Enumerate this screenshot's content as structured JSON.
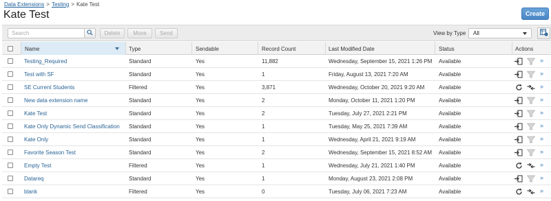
{
  "breadcrumb": {
    "items": [
      "Data Extensions",
      "Testing",
      "Kate Test"
    ],
    "separator": ">"
  },
  "page": {
    "title": "Kate Test"
  },
  "header": {
    "create_label": "Create"
  },
  "toolbar": {
    "search_placeholder": "Search",
    "delete_label": "Delete",
    "move_label": "Move",
    "send_label": "Send",
    "view_by_label": "View by Type",
    "view_by_value": "All"
  },
  "table": {
    "columns": [
      "Name",
      "Type",
      "Sendable",
      "Record Count",
      "Last Modified Date",
      "Status",
      "Actions"
    ],
    "rows": [
      {
        "name": "Testing_Required",
        "type": "Standard",
        "sendable": "Yes",
        "count": "11,882",
        "modified": "Wednesday, September 15, 2021 1:26 PM",
        "status": "Available",
        "kind": "standard"
      },
      {
        "name": "Test with SF",
        "type": "Standard",
        "sendable": "Yes",
        "count": "1",
        "modified": "Friday, August 13, 2021 7:20 AM",
        "status": "Available",
        "kind": "standard"
      },
      {
        "name": "SE Current Students",
        "type": "Filtered",
        "sendable": "Yes",
        "count": "3,871",
        "modified": "Wednesday, October 20, 2021 9:20 AM",
        "status": "Available",
        "kind": "filtered"
      },
      {
        "name": "New data extension name",
        "type": "Standard",
        "sendable": "Yes",
        "count": "2",
        "modified": "Monday, October 11, 2021 1:20 PM",
        "status": "Available",
        "kind": "standard"
      },
      {
        "name": "Kate Test",
        "type": "Standard",
        "sendable": "Yes",
        "count": "2",
        "modified": "Tuesday, July 27, 2021 2:21 PM",
        "status": "Available",
        "kind": "standard"
      },
      {
        "name": "Kate Only Dynamic Send Classification",
        "type": "Standard",
        "sendable": "Yes",
        "count": "1",
        "modified": "Tuesday, May 25, 2021 7:39 AM",
        "status": "Available",
        "kind": "standard"
      },
      {
        "name": "Kate Only",
        "type": "Standard",
        "sendable": "Yes",
        "count": "1",
        "modified": "Wednesday, April 21, 2021 9:19 AM",
        "status": "Available",
        "kind": "standard"
      },
      {
        "name": "Favorite Season Test",
        "type": "Standard",
        "sendable": "Yes",
        "count": "2",
        "modified": "Wednesday, September 15, 2021 8:52 AM",
        "status": "Available",
        "kind": "standard"
      },
      {
        "name": "Empty Test",
        "type": "Filtered",
        "sendable": "Yes",
        "count": "1",
        "modified": "Wednesday, July 21, 2021 1:40 PM",
        "status": "Available",
        "kind": "filtered"
      },
      {
        "name": "Datareq",
        "type": "Standard",
        "sendable": "Yes",
        "count": "1",
        "modified": "Monday, August 23, 2021 2:08 PM",
        "status": "Available",
        "kind": "standard"
      },
      {
        "name": "blank",
        "type": "Filtered",
        "sendable": "Yes",
        "count": "0",
        "modified": "Tuesday, July 06, 2021 7:23 AM",
        "status": "Available",
        "kind": "filtered"
      }
    ]
  },
  "icons": {
    "search": "search-icon",
    "grid_settings": "grid-settings-icon",
    "import": "import-icon",
    "filter": "filter-icon",
    "refresh": "refresh-icon",
    "swap": "swap-icon",
    "more": "more-actions-icon"
  },
  "colors": {
    "accent": "#4a86c6",
    "link": "#2a6496",
    "sorted_header": "#dcebf6"
  }
}
